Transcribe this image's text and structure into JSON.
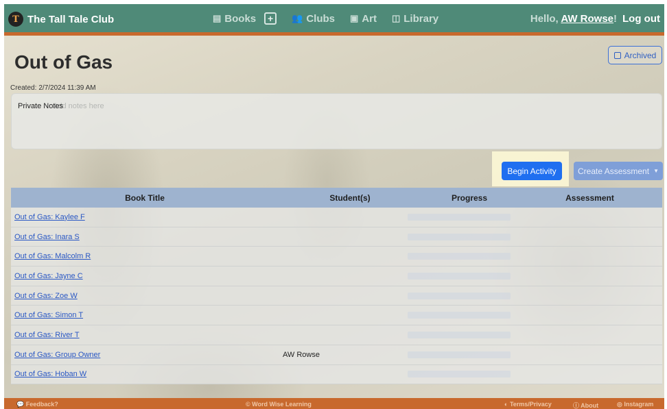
{
  "nav": {
    "brand_logo": "T",
    "brand_name": "The Tall Tale Club",
    "links": {
      "books": "Books",
      "clubs": "Clubs",
      "art": "Art",
      "library": "Library"
    },
    "add_symbol": "+",
    "greeting_prefix": "Hello, ",
    "user_name": "AW Rowse",
    "greeting_suffix": "!",
    "logout": "Log out"
  },
  "page": {
    "title": "Out of Gas",
    "archived_label": "Archived",
    "created_label": "Created:",
    "created_value": "2/7/2024 11:39 AM",
    "notes_label": "Private Notes",
    "notes_placeholder": "Add notes here",
    "begin_activity": "Begin Activity",
    "create_assessment": "Create Assessment"
  },
  "table": {
    "headers": {
      "title": "Book Title",
      "students": "Student(s)",
      "progress": "Progress",
      "assessment": "Assessment"
    },
    "rows": [
      {
        "title": "Out of Gas: Kaylee F",
        "students": "",
        "assessment": ""
      },
      {
        "title": "Out of Gas: Inara S",
        "students": "",
        "assessment": ""
      },
      {
        "title": "Out of Gas: Malcolm R",
        "students": "",
        "assessment": ""
      },
      {
        "title": "Out of Gas: Jayne C",
        "students": "",
        "assessment": ""
      },
      {
        "title": "Out of Gas: Zoe W",
        "students": "",
        "assessment": ""
      },
      {
        "title": "Out of Gas: Simon T",
        "students": "",
        "assessment": ""
      },
      {
        "title": "Out of Gas: River T",
        "students": "",
        "assessment": ""
      },
      {
        "title": "Out of Gas: Group Owner",
        "students": "AW Rowse",
        "assessment": ""
      },
      {
        "title": "Out of Gas: Hoban W",
        "students": "",
        "assessment": ""
      }
    ]
  },
  "footer": {
    "feedback": "Feedback?",
    "center": "Word Wise Learning",
    "terms": "Terms/Privacy",
    "about": "About",
    "instagram": "Instagram"
  },
  "colors": {
    "nav_bg": "#4f8a78",
    "accent_orange": "#c8692d",
    "primary_button": "#1f6ff0",
    "link": "#2957c4"
  }
}
